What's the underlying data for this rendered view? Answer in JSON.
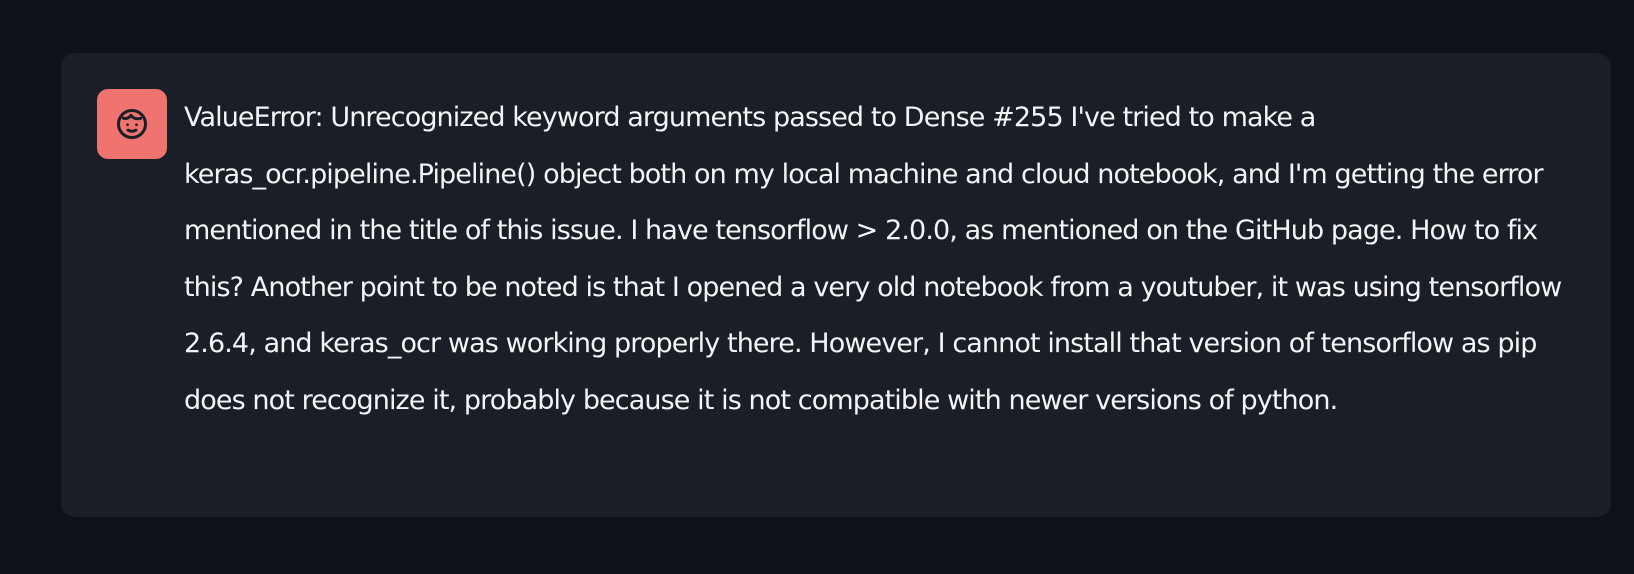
{
  "chat": {
    "message": {
      "avatar_icon": "user-face-icon",
      "avatar_color": "#ef7470",
      "text": "ValueError: Unrecognized keyword arguments passed to Dense #255 I've tried to make a keras_ocr.pipeline.Pipeline() object both on my local machine and cloud notebook, and I'm getting the error mentioned in the title of this issue. I have tensorflow > 2.0.0, as mentioned on the GitHub page. How to fix this? Another point to be noted is that I opened a very old notebook from a youtuber, it was using tensorflow 2.6.4, and keras_ocr was working properly there. However, I cannot install that version of tensorflow as pip does not recognize it, probably because it is not compatible with newer versions of python."
    }
  }
}
